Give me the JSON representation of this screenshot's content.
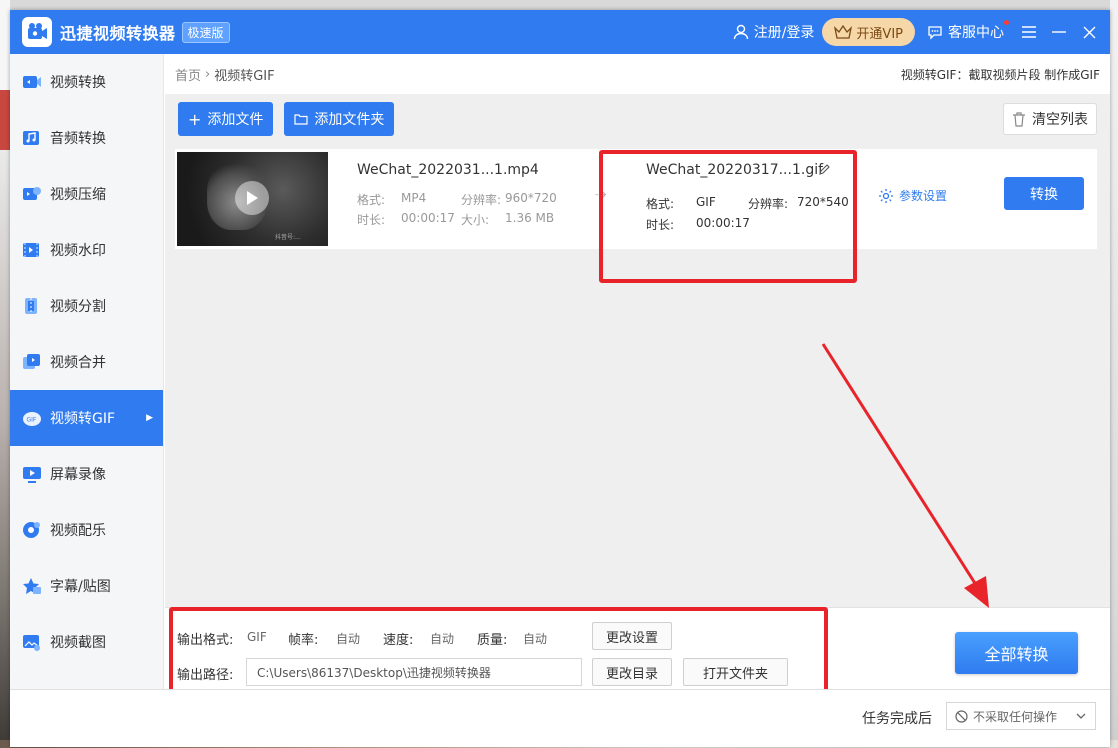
{
  "app": {
    "title": "迅捷视频转换器",
    "edition": "极速版",
    "login": "注册/登录",
    "vip": "开通VIP",
    "service": "客服中心"
  },
  "sidebar": {
    "items": [
      {
        "label": "视频转换",
        "icon": "video-convert-icon"
      },
      {
        "label": "音频转换",
        "icon": "audio-convert-icon"
      },
      {
        "label": "视频压缩",
        "icon": "video-compress-icon"
      },
      {
        "label": "视频水印",
        "icon": "video-watermark-icon"
      },
      {
        "label": "视频分割",
        "icon": "video-split-icon"
      },
      {
        "label": "视频合并",
        "icon": "video-merge-icon"
      },
      {
        "label": "视频转GIF",
        "icon": "gif-icon",
        "active": true
      },
      {
        "label": "屏幕录像",
        "icon": "screen-record-icon"
      },
      {
        "label": "视频配乐",
        "icon": "music-icon"
      },
      {
        "label": "字幕/贴图",
        "icon": "sticker-icon"
      },
      {
        "label": "视频截图",
        "icon": "screenshot-icon"
      }
    ]
  },
  "breadcrumb": {
    "home": "首页",
    "current": "视频转GIF",
    "hint": "视频转GIF：截取视频片段 制作成GIF"
  },
  "toolbar": {
    "add_file": "添加文件",
    "add_folder": "添加文件夹",
    "clear": "清空列表"
  },
  "file": {
    "source": {
      "name": "WeChat_2022031...1.mp4",
      "format_label": "格式:",
      "format": "MP4",
      "resolution_label": "分辨率:",
      "resolution": "960*720",
      "duration_label": "时长:",
      "duration": "00:00:17",
      "size_label": "大小:",
      "size": "1.36 MB"
    },
    "output": {
      "name": "WeChat_20220317...1.gif",
      "format_label": "格式:",
      "format": "GIF",
      "resolution_label": "分辨率:",
      "resolution": "720*540",
      "duration_label": "时长:",
      "duration": "00:00:17"
    },
    "params": "参数设置",
    "convert": "转换",
    "thumb_watermark": "抖音号:..."
  },
  "bottom": {
    "format_label": "输出格式:",
    "format": "GIF",
    "fps_label": "帧率:",
    "fps": "自动",
    "speed_label": "速度:",
    "speed": "自动",
    "quality_label": "质量:",
    "quality": "自动",
    "change_settings": "更改设置",
    "path_label": "输出路径:",
    "path": "C:\\Users\\86137\\Desktop\\迅捷视频转换器",
    "change_dir": "更改目录",
    "open_folder": "打开文件夹",
    "convert_all": "全部转换"
  },
  "status": {
    "after_label": "任务完成后",
    "after_value": "不采取任何操作"
  },
  "colors": {
    "primary": "#2f7bef",
    "annotation": "#e8232a",
    "vip": "#f6d8a8"
  }
}
